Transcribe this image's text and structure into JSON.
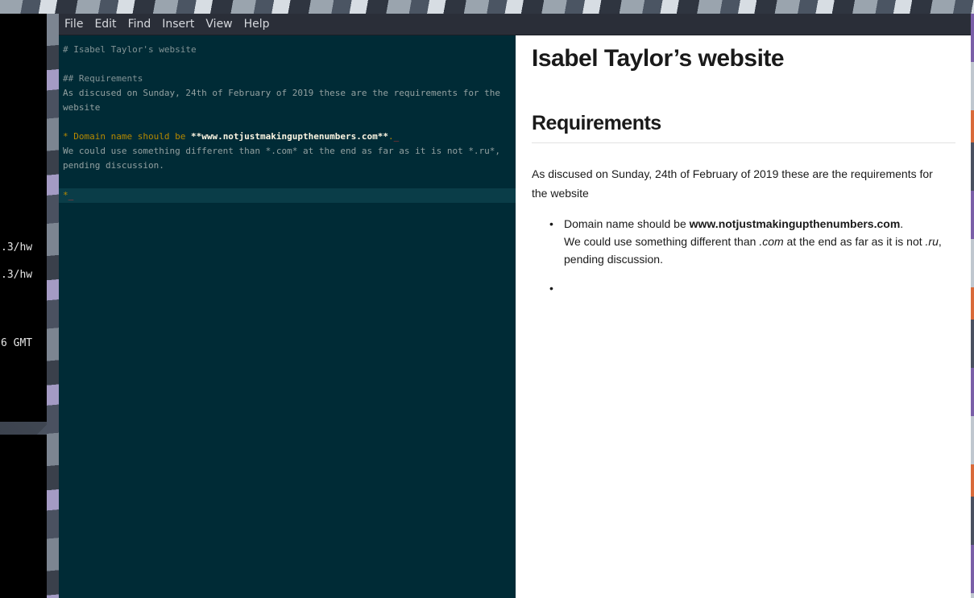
{
  "menu": [
    "File",
    "Edit",
    "Find",
    "Insert",
    "View",
    "Help"
  ],
  "terminal": {
    "lines": [
      ".3/hw",
      ".3/hw",
      "6 GMT"
    ]
  },
  "editor": {
    "line1": "# Isabel Taylor's website",
    "line2": "## Requirements",
    "line3": "As discused on Sunday, 24th of February of 2019 these are the requirements for the",
    "line4": "website",
    "bullet_prefix": "* Domain name should be ",
    "bullet_bold": "**www.notjustmakingupthenumbers.com**",
    "bullet_suffix": ".",
    "bullet_trail": "_",
    "line6": "We could use something different than *.com* at the end as far as it is not *.ru*,",
    "line7": "pending discussion.",
    "cursor_bullet": "*",
    "cursor_mark": "_"
  },
  "preview": {
    "h1": "Isabel Taylor’s website",
    "h2": "Requirements",
    "paragraph": "As discused on Sunday, 24th of February of 2019 these are the requirements for the website",
    "item_prefix": "Domain name should be ",
    "item_bold": "www.notjustmakingupthenumbers.com",
    "item_dot": ".",
    "item_line2_a": "We could use something different than ",
    "item_em1": ".com",
    "item_line2_b": " at the end as far as it is not ",
    "item_em2": ".ru",
    "item_line2_c": ",",
    "item_line3": "pending discussion."
  },
  "colors": {
    "editor_bg": "#002b36",
    "editor_text": "#93a1a1",
    "bullet_yellow": "#b58900",
    "cursor_red": "#dc322f",
    "menubar_bg": "#2a2e38"
  }
}
